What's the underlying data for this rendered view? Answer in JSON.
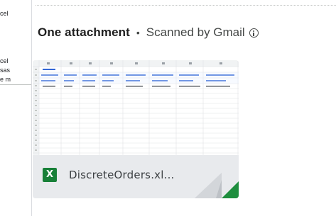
{
  "left_pane": {
    "fragments": [
      "cel",
      "cel",
      "sas",
      "e m"
    ]
  },
  "attachments": {
    "title": "One attachment",
    "separator": "•",
    "scanned": "Scanned by Gmail",
    "files": [
      {
        "name": "DiscreteOrders.xl...",
        "type_icon": "X",
        "icon_semantic": "excel-file-icon",
        "icon_color": "#188038",
        "fold_color": "#1e8e3e"
      }
    ]
  },
  "colors": {
    "card_bg": "#e8eaed",
    "header_link": "#1a73e8"
  }
}
